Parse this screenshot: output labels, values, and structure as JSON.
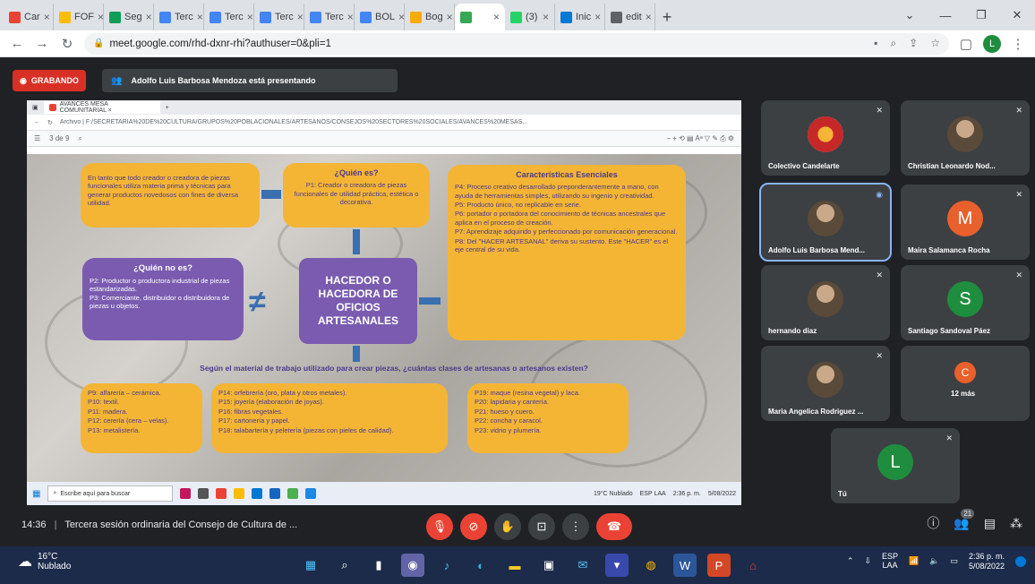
{
  "browser": {
    "tabs": [
      {
        "label": "Car",
        "color": "#ea4335"
      },
      {
        "label": "FOF",
        "color": "#fbbc04"
      },
      {
        "label": "Seg",
        "color": "#0f9d58"
      },
      {
        "label": "Terc",
        "color": "#4285f4"
      },
      {
        "label": "Terc",
        "color": "#4285f4"
      },
      {
        "label": "Terc",
        "color": "#4285f4"
      },
      {
        "label": "Terc",
        "color": "#4285f4"
      },
      {
        "label": "BOL",
        "color": "#4285f4"
      },
      {
        "label": "Bog",
        "color": "#f9ab00"
      },
      {
        "label": "",
        "color": "#34a853",
        "active": true
      },
      {
        "label": "(3)",
        "color": "#25d366"
      },
      {
        "label": "Inic",
        "color": "#0078d4"
      },
      {
        "label": "edit",
        "color": "#5f6368"
      }
    ],
    "url": "meet.google.com/rhd-dxnr-rhi?authuser=0&pli=1",
    "profile_initial": "L"
  },
  "meet": {
    "recording_label": "GRABANDO",
    "presenter_text": "Adolfo Luis Barbosa Mendoza está presentando",
    "meeting_time": "14:36",
    "meeting_title": "Tercera sesión ordinaria del Consejo de Cultura de ...",
    "participant_count": "21",
    "participants": [
      {
        "name": "Colectivo Candelarte",
        "type": "logo"
      },
      {
        "name": "Christian Leonardo Nod...",
        "type": "photo"
      },
      {
        "name": "Adolfo Luis Barbosa Mend...",
        "type": "photo",
        "speaking": true
      },
      {
        "name": "Maira Salamanca Rocha",
        "type": "letter",
        "letter": "M",
        "color": "#e8602c"
      },
      {
        "name": "hernando diaz",
        "type": "photo"
      },
      {
        "name": "Santiago Sandoval Páez",
        "type": "letter",
        "letter": "S",
        "color": "#1e8e3e"
      },
      {
        "name": "Maria Angelica Rodriguez ...",
        "type": "photo"
      },
      {
        "name": "12 más",
        "type": "more",
        "letter": "C",
        "color": "#e8602c"
      },
      {
        "name": "Tú",
        "type": "letter",
        "letter": "L",
        "color": "#1e8e3e"
      }
    ]
  },
  "presentation": {
    "tab_title": "AVANCES MESA COMUNITARIAL ×",
    "path": "Archivo | F:/SECRETARIA%20DE%20CULTURA/GRUPOS%20POBLACIONALES/ARTESANOS/CONSEJOS%20SECTORES%20SOCIALES/AVANCES%20MESAS...",
    "page_info": "3 de 9",
    "center_title": "HACEDOR O HACEDORA DE OFICIOS ARTESANALES",
    "quien_es_title": "¿Quién es?",
    "quien_es_text": "P1: Creador o creadora de piezas funcionales de utilidad práctica, estética o decorativa.",
    "left_top_text": "En tanto que todo creador o creadora de piezas funcionales utiliza materia prima y técnicas para generar productos novedosos con fines de diversa utilidad.",
    "quien_no_title": "¿Quién no es?",
    "quien_no_p2": "P2: Productor o productora industrial de piezas estandarizadas.",
    "quien_no_p3": "P3: Comerciante, distribuidor o distribuidora de piezas u objetos.",
    "caract_title": "Características Esenciales",
    "caract_items": [
      "P4: Proceso creativo desarrollado preponderantemente a mano, con ayuda de herramientas simples, utilizando su ingenio y creatividad.",
      "P5: Producto único, no replicable en serie.",
      "P6: portador o portadora del conocimiento de técnicas ancestrales que aplica en el proceso de creación.",
      "P7: Aprendizaje adquirido y perfeccionado por comunicación generacional.",
      "P8: Del \"HACER ARTESANAL\" deriva su sustento. Este \"HACER\" es el eje central de su vida."
    ],
    "subtitle": "Según el material de trabajo utilizado para crear piezas, ¿cuántas clases de artesanas o artesanos existen?",
    "box1": [
      "P9: alfarería – cerámica.",
      "P10: textil.",
      "P11: madera.",
      "P12: cerería (cera – velas).",
      "P13: metalistería."
    ],
    "box2": [
      "P14: orfebrería (oro, plata y otros metales).",
      "P15: joyería (elaboración de joyas).",
      "P16: fibras vegetales.",
      "P17: cartonería y papel.",
      "P18: talabartería y peletería (piezas con pieles de calidad)."
    ],
    "box3": [
      "P19: maque (resina vegetal) y laca.",
      "P20: lapidaria y cantería.",
      "P21: hueso y cuero.",
      "P22: concha y caracol.",
      "P23: vidrio y plumería."
    ],
    "inner_search": "Escribe aquí para buscar",
    "inner_weather": "19°C Nublado",
    "inner_lang": "ESP LAA",
    "inner_time": "2:36 p. m.",
    "inner_date": "5/08/2022"
  },
  "taskbar": {
    "weather_temp": "16°C",
    "weather_desc": "Nublado",
    "lang": "ESP",
    "lang2": "LAA",
    "time": "2:36 p. m.",
    "date": "5/08/2022"
  }
}
